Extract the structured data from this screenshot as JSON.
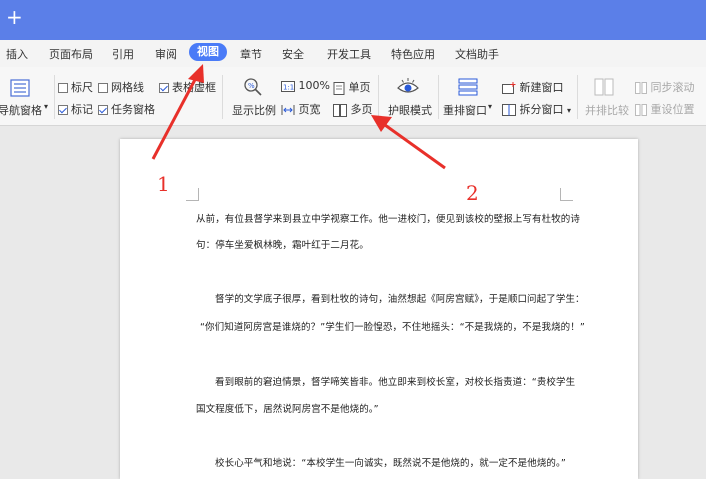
{
  "titlebar": {
    "new_tab_symbol": "+"
  },
  "menu": {
    "items": [
      "插入",
      "页面布局",
      "引用",
      "审阅",
      "视图",
      "章节",
      "安全",
      "开发工具",
      "特色应用",
      "文档助手"
    ],
    "active": "视图"
  },
  "toolbar": {
    "nav_pane": "导航窗格",
    "ruler": "标尺",
    "gridlines": "网格线",
    "table_gridlines": "表格虚框",
    "marker": "标记",
    "task_pane": "任务窗格",
    "zoom_display": "显示比例",
    "zoom_100": "100%",
    "page_width": "页宽",
    "single_page": "单页",
    "multi_page": "多页",
    "eye_mode": "护眼模式",
    "arrange_window": "重排窗口",
    "new_window": "新建窗口",
    "split_window": "拆分窗口",
    "side_by_side": "并排比较",
    "sync_scroll": "同步滚动",
    "reset_position": "重设位置",
    "checkbox_states": {
      "ruler": false,
      "gridlines": false,
      "table_gridlines": true,
      "marker": true,
      "task_pane": true
    }
  },
  "annotations": {
    "label1": "1",
    "label2": "2",
    "arrow_color": "#e8302a"
  },
  "document": {
    "lines": [
      "从前，有位县督学来到县立中学视察工作。他一进校门，便见到该校的壁报上写有杜牧的诗",
      "句：停车坐爱枫林晚，霜叶红于二月花。",
      "督学的文学底子很厚，看到杜牧的诗句，油然想起《阿房宫赋》，于是顺口问起了学生：",
      "“你们知道阿房宫是谁烧的？”学生们一脸惶恐，不住地摇头：“不是我烧的，不是我烧的！”",
      "看到眼前的窘迫情景，督学啼笑皆非。他立即来到校长室，对校长指责道：“贵校学生",
      "国文程度低下，居然说阿房宫不是他烧的。”",
      "校长心平气和地说：“本校学生一向诚实，既然说不是他烧的，就一定不是他烧的。”"
    ]
  },
  "colors": {
    "titlebar": "#5b7fe8",
    "active_tab": "#4a7bf7"
  }
}
